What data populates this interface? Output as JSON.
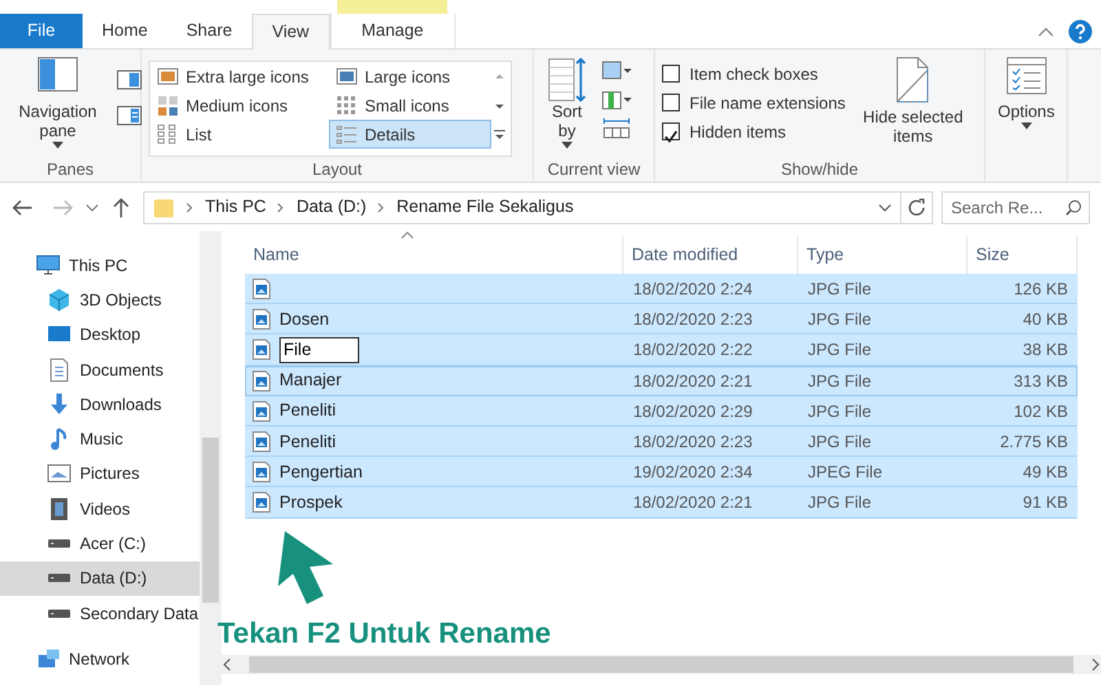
{
  "tabs": [
    {
      "label": "File",
      "kind": "file",
      "selected": false
    },
    {
      "label": "Home",
      "kind": "tab",
      "selected": false
    },
    {
      "label": "Share",
      "kind": "tab",
      "selected": false
    },
    {
      "label": "View",
      "kind": "tab",
      "selected": true
    },
    {
      "label": "Manage",
      "kind": "context",
      "selected": false
    }
  ],
  "ribbon": {
    "panes": {
      "button": "Navigation pane",
      "group": "Panes"
    },
    "layout": {
      "items": [
        {
          "label": "Extra large icons",
          "selected": false
        },
        {
          "label": "Large icons",
          "selected": false
        },
        {
          "label": "Medium icons",
          "selected": false
        },
        {
          "label": "Small icons",
          "selected": false
        },
        {
          "label": "List",
          "selected": false
        },
        {
          "label": "Details",
          "selected": true
        }
      ],
      "group": "Layout"
    },
    "current_view": {
      "button": "Sort by",
      "group": "Current view"
    },
    "show_hide": {
      "checkboxes": [
        {
          "label": "Item check boxes",
          "checked": false
        },
        {
          "label": "File name extensions",
          "checked": false
        },
        {
          "label": "Hidden items",
          "checked": true
        }
      ],
      "button": "Hide selected items",
      "group": "Show/hide"
    },
    "options": {
      "button": "Options"
    }
  },
  "address": {
    "crumbs": [
      "This PC",
      "Data  (D:)",
      "Rename File Sekaligus"
    ],
    "search_placeholder": "Search Re..."
  },
  "nav": [
    {
      "label": "This PC",
      "selected": false
    },
    {
      "label": "3D Objects",
      "selected": false
    },
    {
      "label": "Desktop",
      "selected": false
    },
    {
      "label": "Documents",
      "selected": false
    },
    {
      "label": "Downloads",
      "selected": false
    },
    {
      "label": "Music",
      "selected": false
    },
    {
      "label": "Pictures",
      "selected": false
    },
    {
      "label": "Videos",
      "selected": false
    },
    {
      "label": "Acer (C:)",
      "selected": false
    },
    {
      "label": "Data  (D:)",
      "selected": true
    },
    {
      "label": "Secondary Data",
      "selected": false
    },
    {
      "label": "Network",
      "selected": false
    }
  ],
  "table": {
    "columns": [
      "Name",
      "Date modified",
      "Type",
      "Size"
    ],
    "rows": [
      {
        "name": "",
        "date": "18/02/2020 2:24",
        "type": "JPG File",
        "size": "126 KB",
        "selected": true,
        "editing": false,
        "focused": false
      },
      {
        "name": "Dosen",
        "date": "18/02/2020 2:23",
        "type": "JPG File",
        "size": "40 KB",
        "selected": true,
        "editing": false,
        "focused": false
      },
      {
        "name": "File",
        "date": "18/02/2020 2:22",
        "type": "JPG File",
        "size": "38 KB",
        "selected": true,
        "editing": true,
        "focused": false
      },
      {
        "name": "Manajer",
        "date": "18/02/2020 2:21",
        "type": "JPG File",
        "size": "313 KB",
        "selected": true,
        "editing": false,
        "focused": true
      },
      {
        "name": "Peneliti",
        "date": "18/02/2020 2:29",
        "type": "JPG File",
        "size": "102 KB",
        "selected": true,
        "editing": false,
        "focused": false
      },
      {
        "name": "Peneliti",
        "date": "18/02/2020 2:23",
        "type": "JPG File",
        "size": "2.775 KB",
        "selected": true,
        "editing": false,
        "focused": false
      },
      {
        "name": "Pengertian",
        "date": "19/02/2020 2:34",
        "type": "JPEG File",
        "size": "49 KB",
        "selected": true,
        "editing": false,
        "focused": false
      },
      {
        "name": "Prospek",
        "date": "18/02/2020 2:21",
        "type": "JPG File",
        "size": "91 KB",
        "selected": true,
        "editing": false,
        "focused": false
      }
    ]
  },
  "annotation": {
    "text": "Tekan F2 Untuk Rename"
  }
}
